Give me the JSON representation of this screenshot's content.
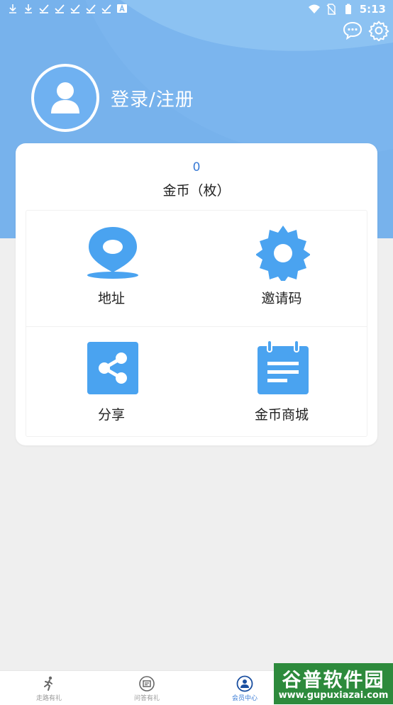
{
  "status_bar": {
    "time": "5:13",
    "left_icons": [
      "download-icon",
      "download-icon",
      "check-icon",
      "check-icon",
      "check-icon",
      "check-icon",
      "check-icon",
      "a-icon"
    ],
    "right_icons": [
      "wifi-icon",
      "sim-off-icon",
      "battery-icon"
    ]
  },
  "header": {
    "login_label": "登录/注册",
    "actions": [
      "chat-icon",
      "settings-icon"
    ]
  },
  "coins": {
    "count": "0",
    "label": "金币（枚）"
  },
  "grid": [
    {
      "label": "地址",
      "icon": "location-pin-icon"
    },
    {
      "label": "邀请码",
      "icon": "gear-icon"
    },
    {
      "label": "分享",
      "icon": "share-icon"
    },
    {
      "label": "金币商城",
      "icon": "notepad-icon"
    }
  ],
  "tabs": [
    {
      "label": "走路有礼",
      "icon": "runner-icon",
      "active": false
    },
    {
      "label": "问答有礼",
      "icon": "qa-icon",
      "active": false
    },
    {
      "label": "会员中心",
      "icon": "member-icon",
      "active": true
    }
  ],
  "watermark": {
    "line1": "谷普软件园",
    "line2": "www.gupuxiazai.com"
  },
  "colors": {
    "header_bg": "#7bb5ee",
    "accent": "#3a7bd5",
    "icon_blue": "#4aa3f0",
    "page_bg": "#efefef"
  }
}
